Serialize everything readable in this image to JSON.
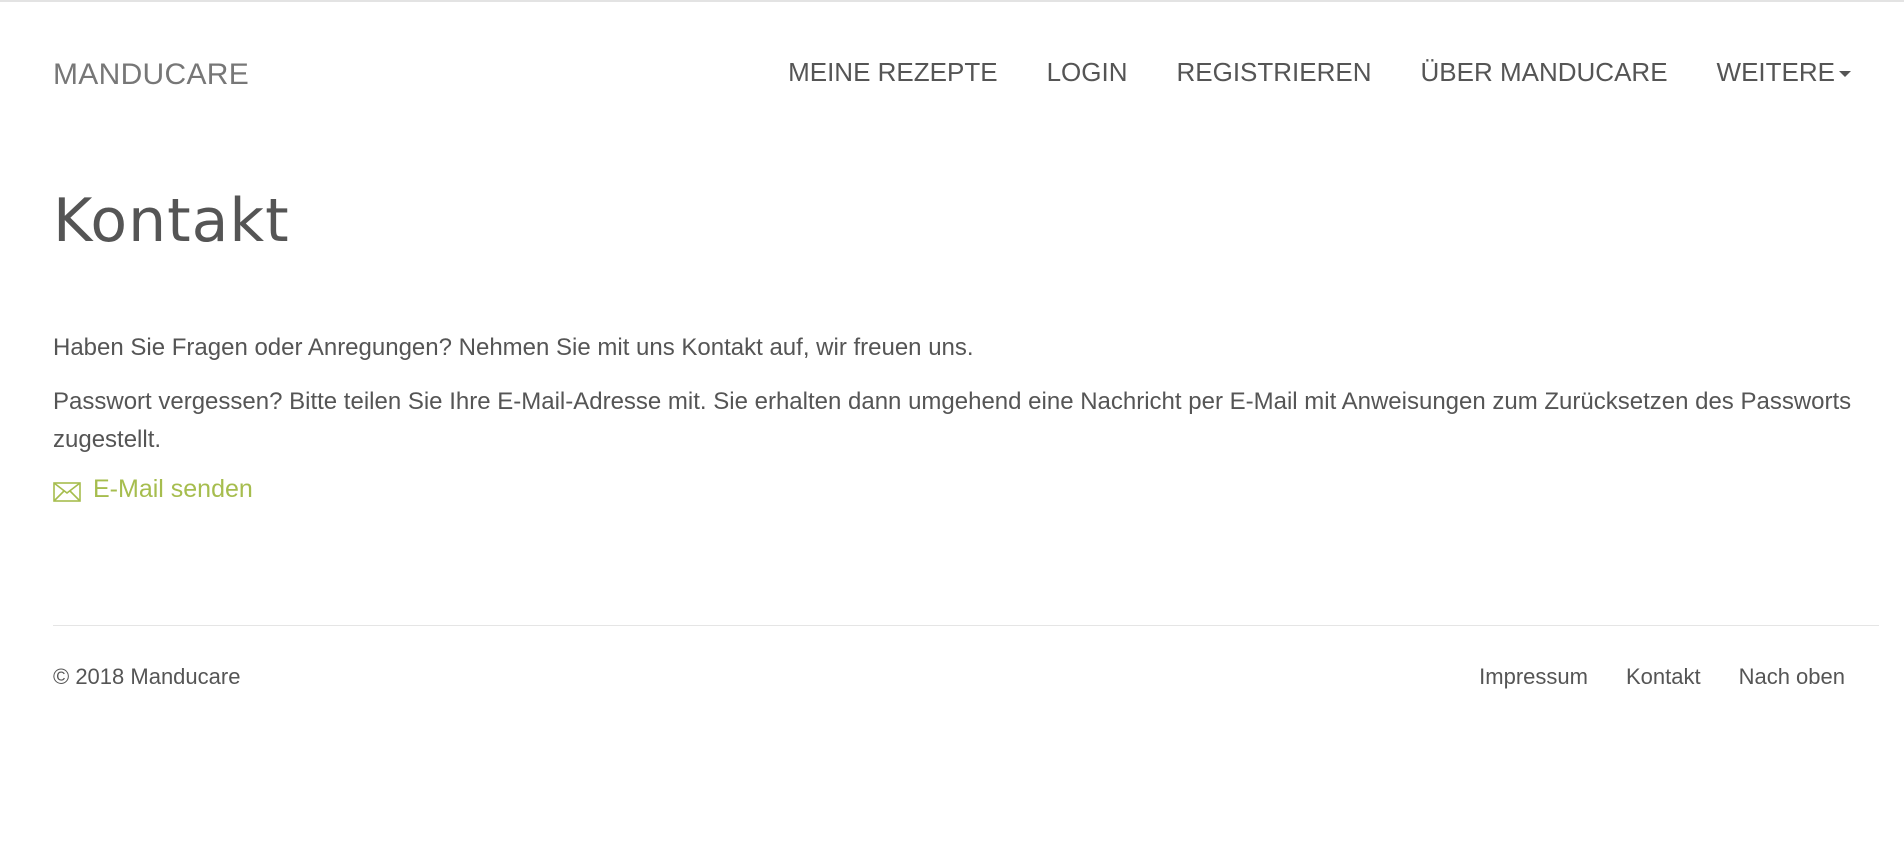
{
  "header": {
    "brand": "MANDUCARE",
    "nav": {
      "my_recipes": "MEINE REZEPTE",
      "login": "LOGIN",
      "register": "REGISTRIEREN",
      "about": "ÜBER MANDUCARE",
      "more": "WEITERE"
    }
  },
  "main": {
    "title": "Kontakt",
    "intro": "Haben Sie Fragen oder Anregungen? Nehmen Sie mit uns Kontakt auf, wir freuen uns.",
    "password_note": "Passwort vergessen? Bitte teilen Sie Ihre E-Mail-Adresse mit. Sie erhalten dann umgehend eine Nachricht per E-Mail mit Anweisungen zum Zurücksetzen des Passworts zugestellt.",
    "send_mail": "E-Mail senden",
    "send_mail_icon": "envelope-icon"
  },
  "footer": {
    "copyright": "© 2018 Manducare",
    "links": {
      "imprint": "Impressum",
      "contact": "Kontakt",
      "back_to_top": "Nach oben"
    }
  },
  "colors": {
    "text": "#555555",
    "brand": "#777777",
    "accent": "#a6bd4e",
    "rule": "#e5e5e5"
  }
}
